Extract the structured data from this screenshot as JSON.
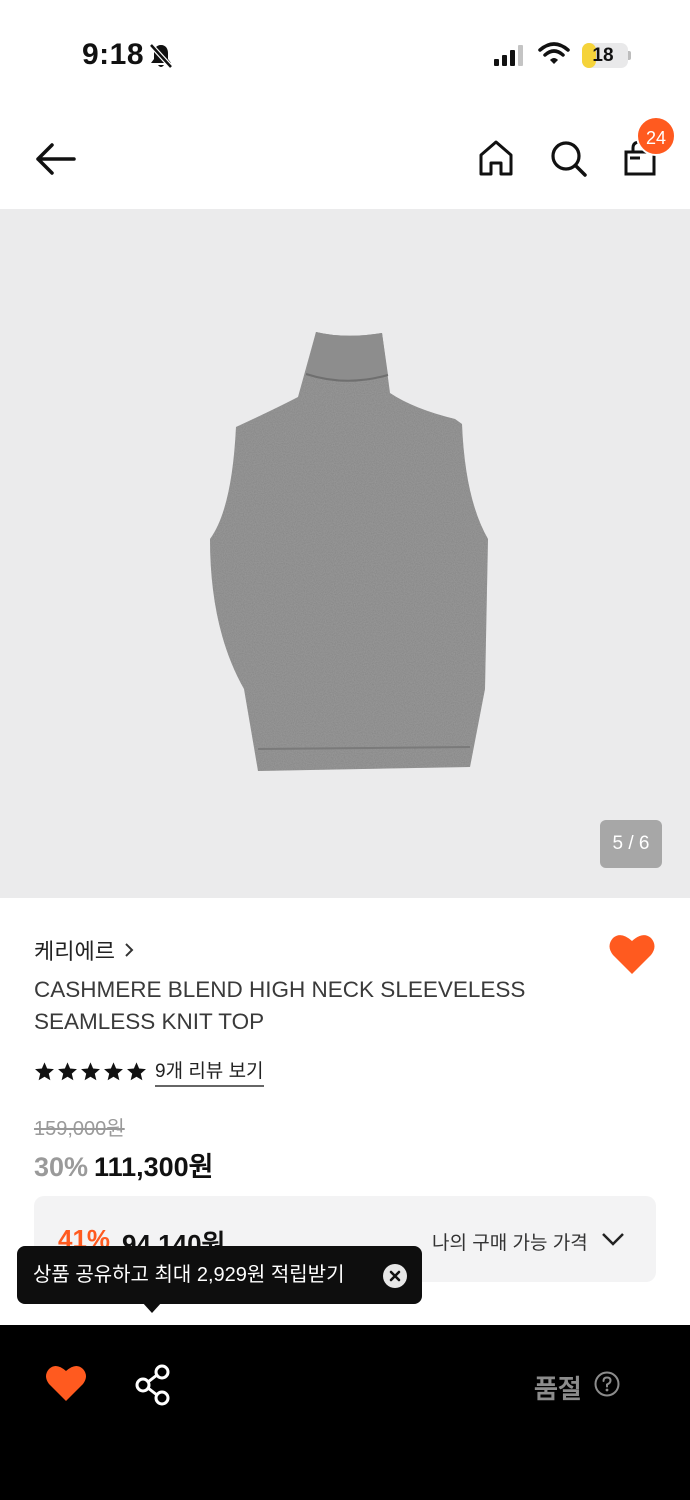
{
  "status_bar": {
    "time": "9:18",
    "battery_level": "18",
    "battery_fraction": 0.18,
    "icons": [
      "bell-off-icon",
      "signal-icon",
      "wifi-icon",
      "battery-icon"
    ]
  },
  "header": {
    "cart_count": "24",
    "icons": [
      "back-arrow-icon",
      "home-icon",
      "search-icon",
      "shopping-bag-icon"
    ]
  },
  "gallery": {
    "counter": "5 / 6",
    "current": 5,
    "total": 6
  },
  "product": {
    "brand": "케리에르",
    "title": "CASHMERE BLEND HIGH NECK SLEEVELESS SEAMLESS KNIT TOP",
    "rating_stars": 5,
    "review_link": "9개 리뷰 보기",
    "original_price": "159,000원",
    "discount_rate": "30%",
    "sale_price": "111,300원"
  },
  "my_price": {
    "rate": "41%",
    "price": "94,140원",
    "label": "나의 구매 가능 가격"
  },
  "tooltip": {
    "text": "상품 공유하고 최대 2,929원 적립받기"
  },
  "bottom_bar": {
    "status": "품절"
  },
  "colors": {
    "accent": "#ff5a1f",
    "bottom_bar": "#000000",
    "image_bg": "#ebebec",
    "knit": "#858585"
  }
}
